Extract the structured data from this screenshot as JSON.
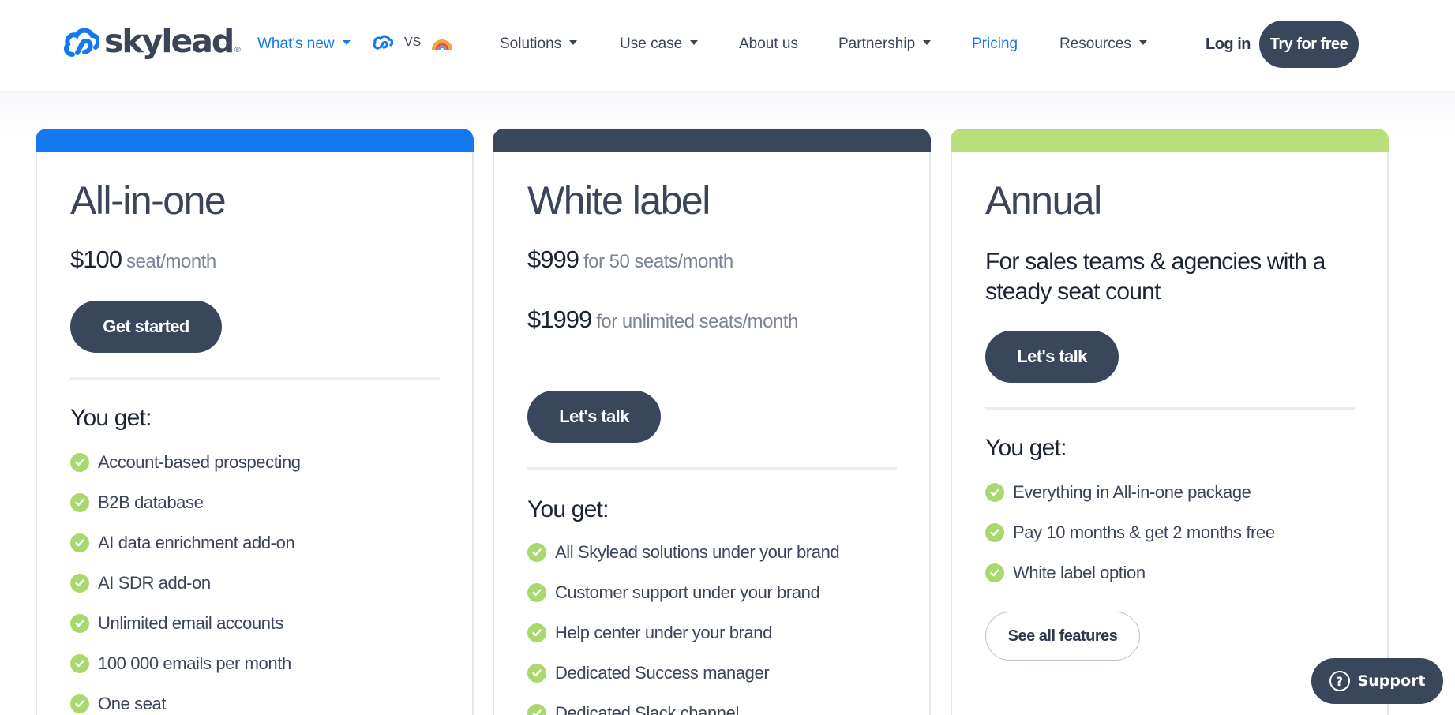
{
  "header": {
    "logo_text": "skylead",
    "logo_reg": "®",
    "whats_new": "What's new",
    "vs": "VS",
    "nav": {
      "solutions": "Solutions",
      "use_case": "Use case",
      "about_us": "About us",
      "partnership": "Partnership",
      "pricing": "Pricing",
      "resources": "Resources"
    },
    "login": "Log in",
    "try_free": "Try for free"
  },
  "colors": {
    "accent_blue": "#1478f0",
    "dark_slate": "#39465c",
    "lime": "#b8e07a",
    "check_green": "#a9d86e"
  },
  "plans": {
    "all_in_one": {
      "bar_color": "#1478f0",
      "title": "All-in-one",
      "price": "$100",
      "price_unit": "seat/month",
      "cta": "Get started",
      "you_get": "You get:",
      "features": [
        "Account-based prospecting",
        "B2B database",
        "AI data enrichment add-on",
        "AI SDR add-on",
        "Unlimited email accounts",
        "100 000 emails per month",
        "One seat"
      ]
    },
    "white_label": {
      "bar_color": "#39465c",
      "title": "White label",
      "price_1": "$999",
      "price_1_unit": "for 50 seats/month",
      "price_2": "$1999",
      "price_2_unit": "for unlimited seats/month",
      "cta": "Let's talk",
      "you_get": "You get:",
      "features": [
        "All Skylead solutions under your brand",
        "Customer support under your brand",
        "Help center under your brand",
        "Dedicated Success manager",
        "Dedicated Slack channel"
      ]
    },
    "annual": {
      "bar_color": "#b8e07a",
      "title": "Annual",
      "subtitle": "For sales teams & agencies with a steady seat count",
      "cta": "Let's talk",
      "you_get": "You get:",
      "features": [
        "Everything in All-in-one package",
        "Pay 10 months & get 2 months free",
        "White label option"
      ],
      "see_all": "See all features"
    }
  },
  "support": {
    "icon": "?",
    "label": "Support"
  }
}
